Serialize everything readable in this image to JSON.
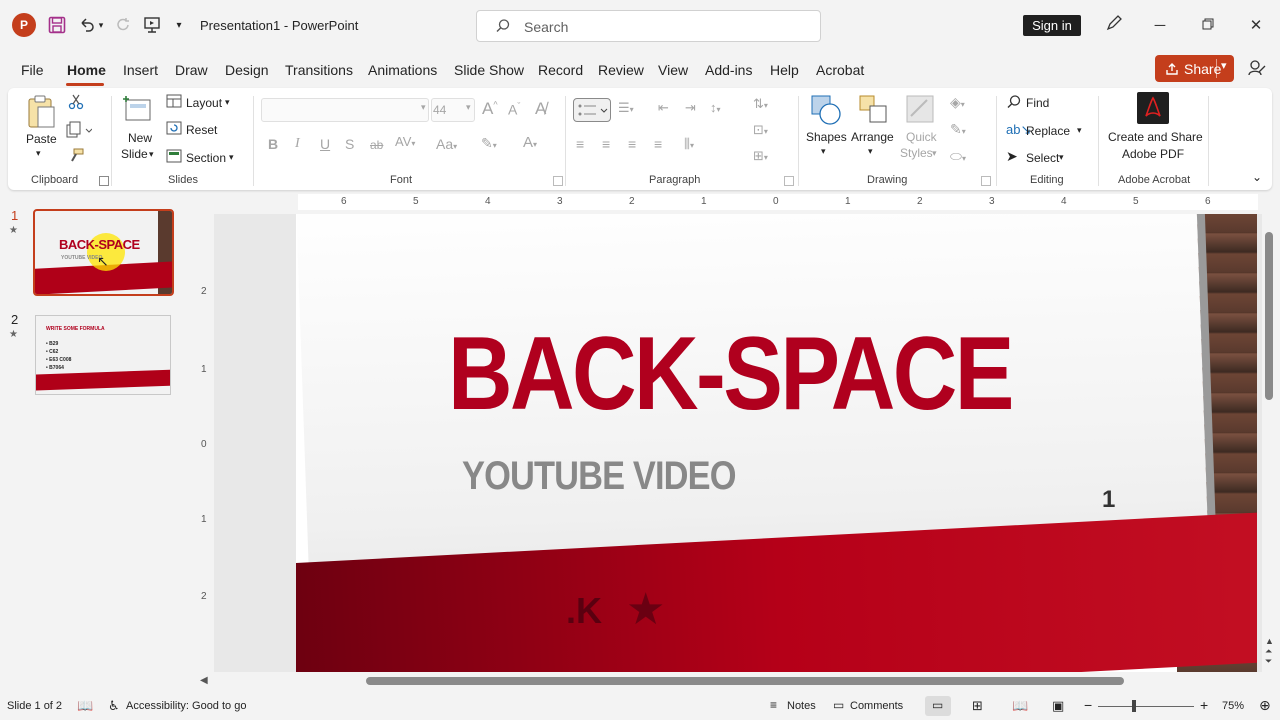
{
  "app": {
    "doc_name": "Presentation1",
    "separator": "-",
    "app_name": "PowerPoint",
    "logo_letter": "P"
  },
  "titlebar": {
    "search_placeholder": "Search",
    "signin_label": "Sign in"
  },
  "tabs": [
    "File",
    "Home",
    "Insert",
    "Draw",
    "Design",
    "Transitions",
    "Animations",
    "Slide Show",
    "Record",
    "Review",
    "View",
    "Add-ins",
    "Help",
    "Acrobat"
  ],
  "share_label": "Share",
  "ribbon": {
    "clipboard": {
      "paste": "Paste",
      "group": "Clipboard"
    },
    "slides": {
      "new_slide_1": "New",
      "new_slide_2": "Slide",
      "layout": "Layout",
      "reset": "Reset",
      "section": "Section",
      "group": "Slides"
    },
    "font": {
      "size": "44",
      "group": "Font"
    },
    "paragraph": {
      "group": "Paragraph"
    },
    "drawing": {
      "shapes": "Shapes",
      "arrange": "Arrange",
      "quick_1": "Quick",
      "quick_2": "Styles",
      "group": "Drawing"
    },
    "editing": {
      "find": "Find",
      "replace": "Replace",
      "select": "Select",
      "group": "Editing"
    },
    "acrobat": {
      "create_1": "Create and Share",
      "create_2": "Adobe PDF",
      "group": "Adobe Acrobat"
    }
  },
  "thumbnails": [
    {
      "num": "1",
      "title": "BACK-SPACE",
      "sub": "YOUTUBE VIDEO"
    },
    {
      "num": "2",
      "title": "WRITE SOME FORMULA",
      "bullets": [
        "B29",
        "C62",
        "E63 C008",
        "B7064"
      ]
    }
  ],
  "hruler_ticks": [
    "6",
    "5",
    "4",
    "3",
    "2",
    "1",
    "0",
    "1",
    "2",
    "3",
    "4",
    "5",
    "6"
  ],
  "vruler_ticks": [
    "2",
    "1",
    "0",
    "1",
    "2"
  ],
  "slide": {
    "title": "BACK-SPACE",
    "subtitle": "YOUTUBE VIDEO",
    "number": "1",
    "band_text": ".K",
    "band_star": "★"
  },
  "status": {
    "slide_info": "Slide 1 of 2",
    "accessibility": "Accessibility: Good to go",
    "notes": "Notes",
    "comments": "Comments",
    "zoom_minus": "−",
    "zoom_plus": "+",
    "zoom": "75%"
  },
  "colors": {
    "accent": "#c43e1c",
    "title_red": "#b0001e"
  }
}
